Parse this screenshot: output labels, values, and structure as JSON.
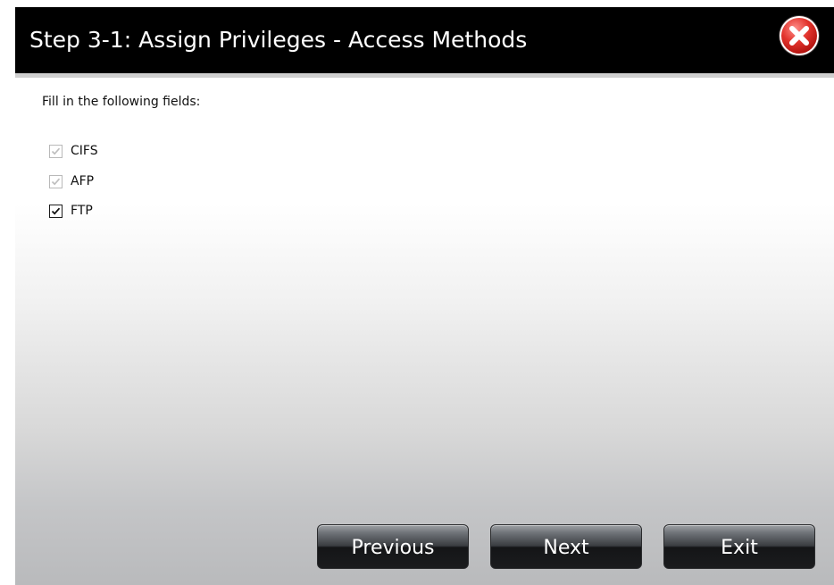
{
  "dialog": {
    "title": "Step 3-1: Assign Privileges - Access Methods",
    "close_icon": "close-x-icon",
    "close_color": "#d12a24"
  },
  "form": {
    "instructions": "Fill in the following fields:",
    "options": [
      {
        "label": "CIFS",
        "checked": true,
        "enabled": false
      },
      {
        "label": "AFP",
        "checked": true,
        "enabled": false
      },
      {
        "label": "FTP",
        "checked": true,
        "enabled": true
      }
    ]
  },
  "buttons": {
    "previous": "Previous",
    "next": "Next",
    "exit": "Exit"
  },
  "theme": {
    "titlebar_bg": "#000000",
    "title_text": "#ffffff",
    "button_text": "#ffffff"
  }
}
